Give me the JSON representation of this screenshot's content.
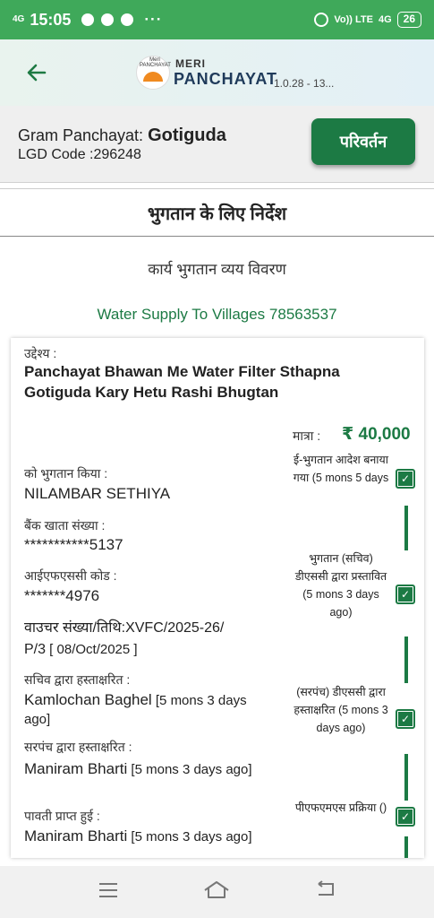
{
  "status_bar": {
    "network_left": "4G",
    "time": "15:05",
    "more": "···",
    "volte": "Vo)) LTE",
    "network_right": "4G",
    "battery": "26"
  },
  "header": {
    "logo_small_text": "Meri PANCHAYAT",
    "brand_meri": "MERI",
    "brand_panchayat": "PANCHAYAT",
    "version": "1.0.28 - 13..."
  },
  "gp": {
    "label": "Gram Panchayat: ",
    "name": "Gotiguda",
    "lgd_code": "LGD Code :296248",
    "change_button": "परिवर्तन"
  },
  "section_title": "भुगतान के लिए निर्देश",
  "sub_title": "कार्य भुगतान व्यय विवरण",
  "scheme": "Water Supply To Villages  78563537",
  "card": {
    "purpose_label": "उद्देश्य :",
    "purpose_text": "Panchayat Bhawan Me Water Filter Sthapna Gotiguda Kary Hetu Rashi Bhugtan",
    "amount_label": "मात्रा :",
    "amount_value": "₹ 40,000",
    "fields": [
      {
        "label": "को भुगतान किया :",
        "value": "NILAMBAR SETHIYA"
      },
      {
        "label": "बैंक खाता संख्या :",
        "value": "***********5137"
      },
      {
        "label": "आईएफएससी कोड :",
        "value": "*******4976"
      },
      {
        "label": "वाउचर संख्या/तिथि:XVFC/2025-26/",
        "value": "P/3",
        "value_extra": " [ 08/Oct/2025 ]"
      },
      {
        "label": "सचिव द्वारा हस्ताक्षरित :",
        "value": "Kamlochan Baghel",
        "value_extra": " [5 mons 3 days ago]"
      },
      {
        "label": "सरपंच द्वारा हस्ताक्षरित :",
        "value": "Maniram Bharti",
        "value_extra": "  [5 mons 3 days ago]"
      },
      {
        "label": "पावती प्राप्त हुई :",
        "value": "Maniram Bharti",
        "value_extra": "  [5 mons 3 days ago]"
      }
    ],
    "steps": [
      {
        "text": "ई-भुगतान आदेश बनाया गया (5 mons 5 days"
      },
      {
        "text": "भुगतान (सचिव) डीएससी द्वारा प्रस्तावित (5 mons 3 days ago)"
      },
      {
        "text": "(सरपंच) डीएससी द्वारा हस्ताक्षरित (5 mons 3 days ago)"
      },
      {
        "text": "पीएफएमएस प्रक्रिया ()"
      }
    ]
  },
  "colors": {
    "status_bar": "#3fa95a",
    "accent_green": "#1c7a44"
  },
  "nav": {
    "menu_icon": "menu-icon",
    "home_icon": "home-icon",
    "back_icon": "back-icon"
  }
}
